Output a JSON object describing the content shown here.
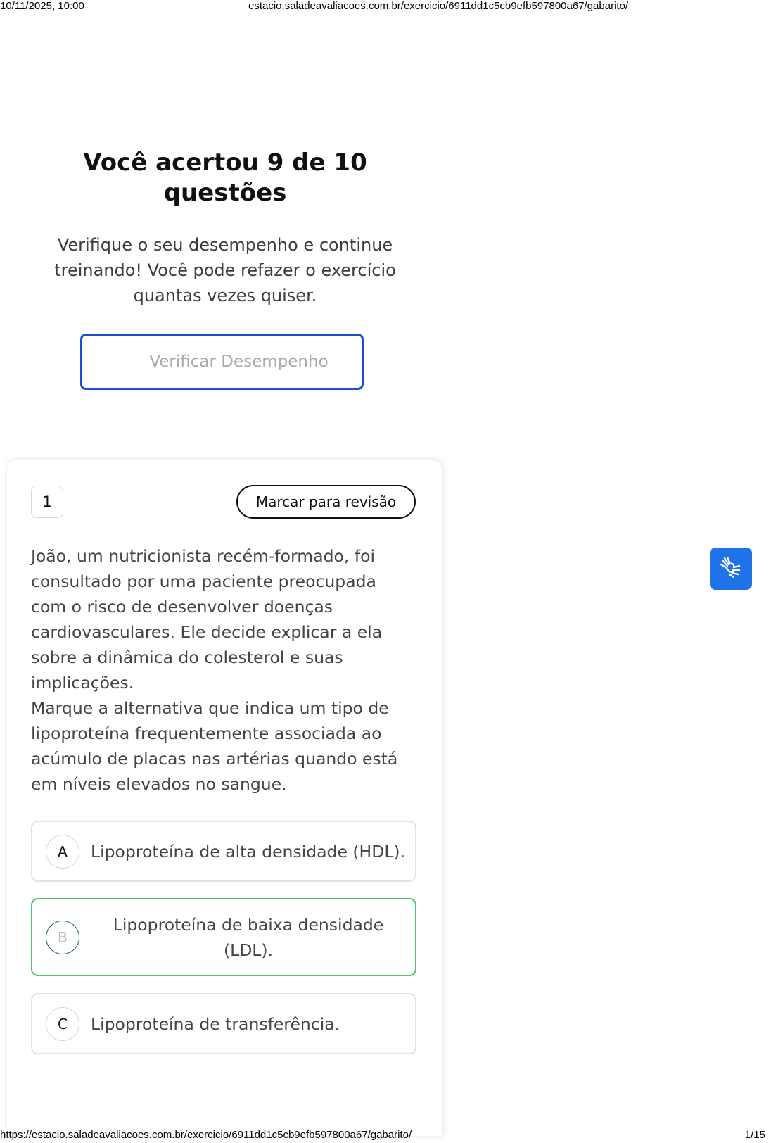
{
  "print_header": {
    "datetime": "10/11/2025, 10:00",
    "url": "estacio.saladeavaliacoes.com.br/exercicio/6911dd1c5cb9efb597800a67/gabarito/"
  },
  "print_footer": {
    "url": "https://estacio.saladeavaliacoes.com.br/exercicio/6911dd1c5cb9efb597800a67/gabarito/",
    "page": "1/15"
  },
  "summary": {
    "title": "Você acertou 9 de 10 questões",
    "subtitle": "Verifique o seu desempenho e continue treinando! Você pode refazer o exercício quantas vezes quiser.",
    "button_label": "Verificar Desempenho"
  },
  "question": {
    "number": "1",
    "review_button": "Marcar para revisão",
    "statement": "João, um nutricionista recém-formado, foi consultado por uma paciente preocupada com o risco de desenvolver doenças cardiovasculares. Ele decide explicar a ela sobre a dinâmica do colesterol e suas implicações.",
    "prompt": "Marque a alternativa que indica um tipo de lipoproteína frequentemente associada ao acúmulo de placas nas artérias quando está em níveis elevados no sangue.",
    "options": [
      {
        "letter": "A",
        "text": "Lipoproteína de alta densidade (HDL)."
      },
      {
        "letter": "B",
        "text": "Lipoproteína de baixa densidade (LDL).",
        "state": "correct"
      },
      {
        "letter": "C",
        "text": "Lipoproteína de transferência."
      }
    ]
  },
  "colors": {
    "primary_button_border": "#1f4fd1",
    "correct_border": "#4cc36b",
    "accessibility_button": "#1f73e8"
  },
  "icons": {
    "accessibility": "sign-language-hands-icon"
  }
}
